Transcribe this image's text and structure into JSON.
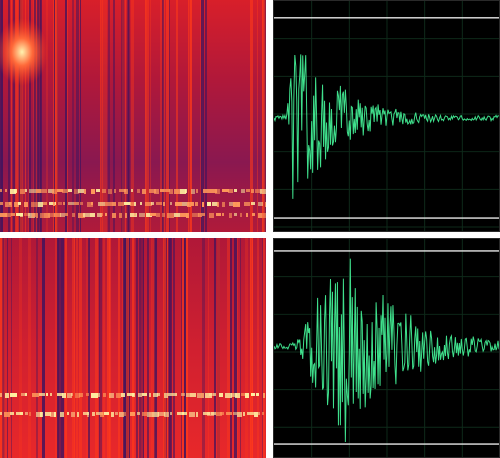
{
  "colors": {
    "background": "#ffffff",
    "spectrogram_base": "#3a1360",
    "spectrogram_mid": "#c01c28",
    "spectrogram_hot": "#ff3a1a",
    "spectrogram_peak": "#fff0a0",
    "waveform_background": "#000000",
    "waveform_trace": "#3fe08c",
    "waveform_guides": "#e8e8e8",
    "waveform_grid": "#0e2a1a"
  },
  "panels": [
    {
      "kind": "spectrogram",
      "name": "spectrogram-top",
      "harmonic_rows": 4
    },
    {
      "kind": "waveform",
      "name": "waveform-top",
      "envelope": "sharp-attack-decay"
    },
    {
      "kind": "spectrogram",
      "name": "spectrogram-bottom",
      "harmonic_rows": 2
    },
    {
      "kind": "waveform",
      "name": "waveform-bottom",
      "envelope": "gradual-attack-decay"
    }
  ]
}
